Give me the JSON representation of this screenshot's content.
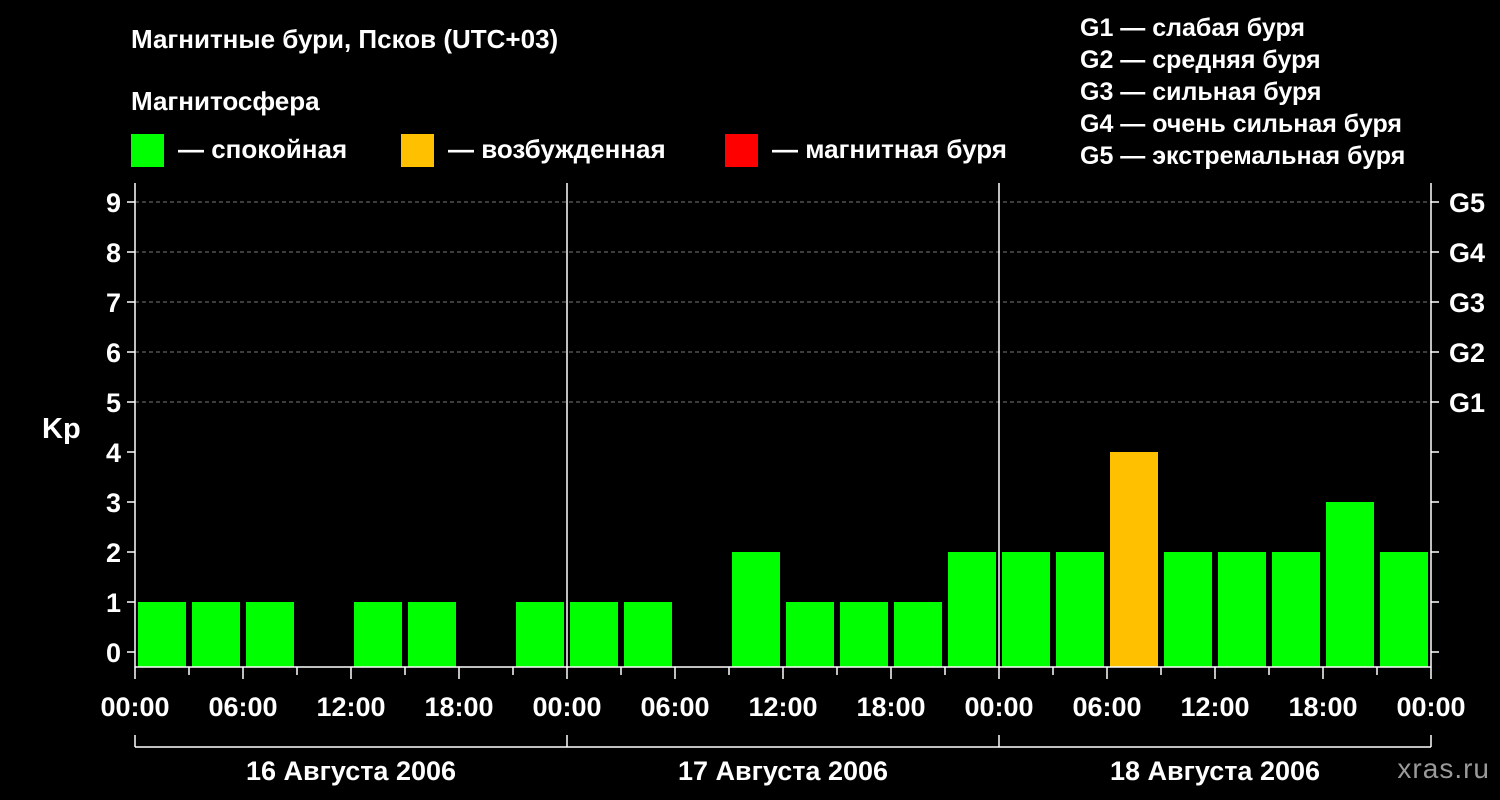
{
  "title": "Магнитные бури, Псков (UTC+03)",
  "magnetosphere_title": "Магнитосфера",
  "legend": [
    {
      "label": "— спокойная",
      "color": "#00ff00"
    },
    {
      "label": "— возбужденная",
      "color": "#ffc000"
    },
    {
      "label": "— магнитная буря",
      "color": "#ff0000"
    }
  ],
  "g_legend": [
    "G1 — слабая буря",
    "G2 — средняя буря",
    "G3 — сильная буря",
    "G4 — очень сильная буря",
    "G5 — экстремальная буря"
  ],
  "source": "xras.ru",
  "chart_data": {
    "type": "bar",
    "ylabel": "Kp",
    "ylim": [
      0,
      9
    ],
    "y_ticks": [
      "0",
      "1",
      "2",
      "3",
      "4",
      "5",
      "6",
      "7",
      "8",
      "9"
    ],
    "g_ticks": [
      {
        "kp": 5,
        "label": "G1"
      },
      {
        "kp": 6,
        "label": "G2"
      },
      {
        "kp": 7,
        "label": "G3"
      },
      {
        "kp": 8,
        "label": "G4"
      },
      {
        "kp": 9,
        "label": "G5"
      }
    ],
    "x_tick_labels": [
      "00:00",
      "06:00",
      "12:00",
      "18:00",
      "00:00",
      "06:00",
      "12:00",
      "18:00",
      "00:00",
      "06:00",
      "12:00",
      "18:00",
      "00:00"
    ],
    "days": [
      "16 Августа 2006",
      "17 Августа 2006",
      "18 Августа 2006"
    ],
    "interval_hours": 3,
    "values": [
      1,
      1,
      1,
      0,
      1,
      1,
      0,
      1,
      1,
      1,
      0,
      2,
      1,
      1,
      1,
      2,
      2,
      2,
      4,
      2,
      2,
      2,
      3,
      2
    ],
    "grid": "dashed horizontal at 5–9",
    "color_rule": {
      "quiet_max": 3,
      "quiet": "#00ff00",
      "active": "#ffc000",
      "storm_min": 5,
      "storm": "#ff0000"
    }
  }
}
